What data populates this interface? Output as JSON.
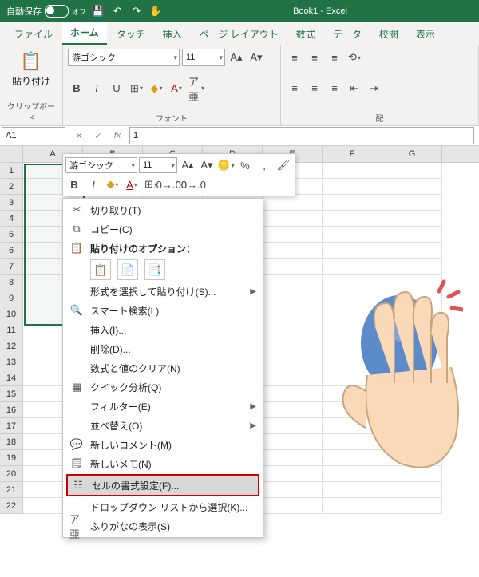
{
  "title": {
    "autosave_label": "自動保存",
    "autosave_state": "オフ",
    "doc": "Book1 - Excel"
  },
  "tabs": [
    "ファイル",
    "ホーム",
    "タッチ",
    "挿入",
    "ページ レイアウト",
    "数式",
    "データ",
    "校閲",
    "表示"
  ],
  "active_tab": 1,
  "ribbon": {
    "clipboard": {
      "paste": "貼り付け",
      "group": "クリップボード"
    },
    "font": {
      "name": "游ゴシック",
      "size": "11",
      "group": "フォント"
    },
    "align": {
      "group": "配"
    }
  },
  "namebox": "A1",
  "formula": "1",
  "cols": [
    "A",
    "B",
    "C",
    "D",
    "E",
    "F",
    "G"
  ],
  "rows": [
    "1",
    "2",
    "3",
    "4",
    "5",
    "6",
    "7",
    "8",
    "9",
    "10",
    "11",
    "12",
    "13",
    "14",
    "15",
    "16",
    "17",
    "18",
    "19",
    "20",
    "21",
    "22"
  ],
  "mini": {
    "font": "游ゴシック",
    "size": "11"
  },
  "ctx": {
    "cut": "切り取り(T)",
    "copy": "コピー(C)",
    "paste_header": "貼り付けのオプション：",
    "paste_special": "形式を選択して貼り付け(S)...",
    "smart": "スマート検索(L)",
    "insert": "挿入(I)...",
    "delete": "削除(D)...",
    "clear": "数式と値のクリア(N)",
    "quick": "クイック分析(Q)",
    "filter": "フィルター(E)",
    "sort": "並べ替え(O)",
    "comment": "新しいコメント(M)",
    "note": "新しいメモ(N)",
    "format": "セルの書式設定(F)...",
    "dropdown": "ドロップダウン リストから選択(K)...",
    "furigana": "ふりがなの表示(S)"
  }
}
